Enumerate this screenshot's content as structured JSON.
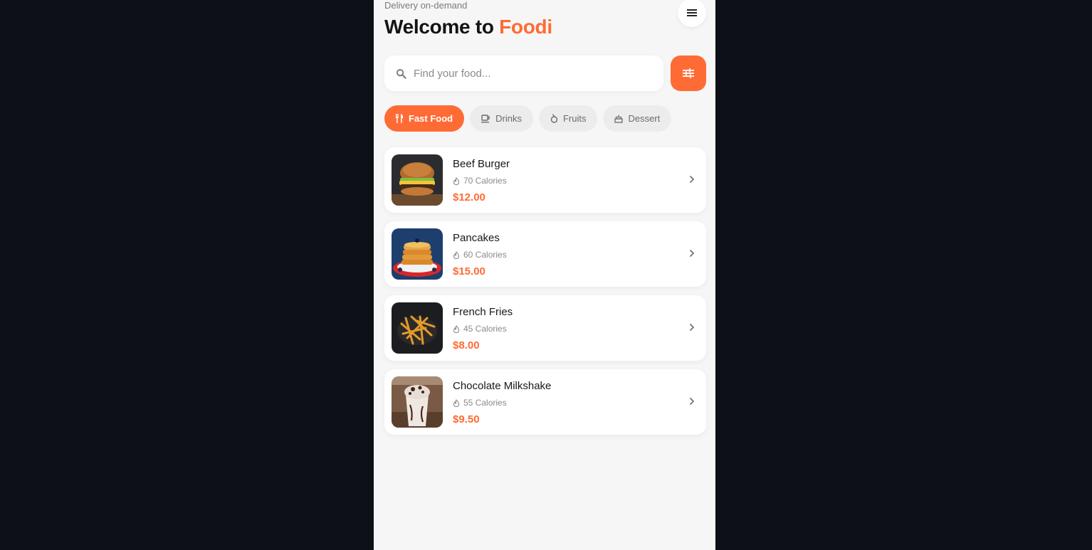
{
  "header": {
    "subtitle": "Delivery on-demand",
    "title_prefix": "Welcome to",
    "title_brand": "Foodi"
  },
  "search": {
    "placeholder": "Find your food...",
    "value": ""
  },
  "categories": [
    {
      "label": "Fast Food",
      "icon": "utensils-icon",
      "active": true
    },
    {
      "label": "Drinks",
      "icon": "cup-icon",
      "active": false
    },
    {
      "label": "Fruits",
      "icon": "fruit-icon",
      "active": false
    },
    {
      "label": "Dessert",
      "icon": "cake-icon",
      "active": false
    }
  ],
  "items": [
    {
      "name": "Beef Burger",
      "calories": "70 Calories",
      "price": "$12.00"
    },
    {
      "name": "Pancakes",
      "calories": "60 Calories",
      "price": "$15.00"
    },
    {
      "name": "French Fries",
      "calories": "45 Calories",
      "price": "$8.00"
    },
    {
      "name": "Chocolate Milkshake",
      "calories": "55 Calories",
      "price": "$9.50"
    }
  ],
  "colors": {
    "accent": "#ff6b35",
    "background": "#f6f6f6",
    "page": "#0d1017"
  }
}
